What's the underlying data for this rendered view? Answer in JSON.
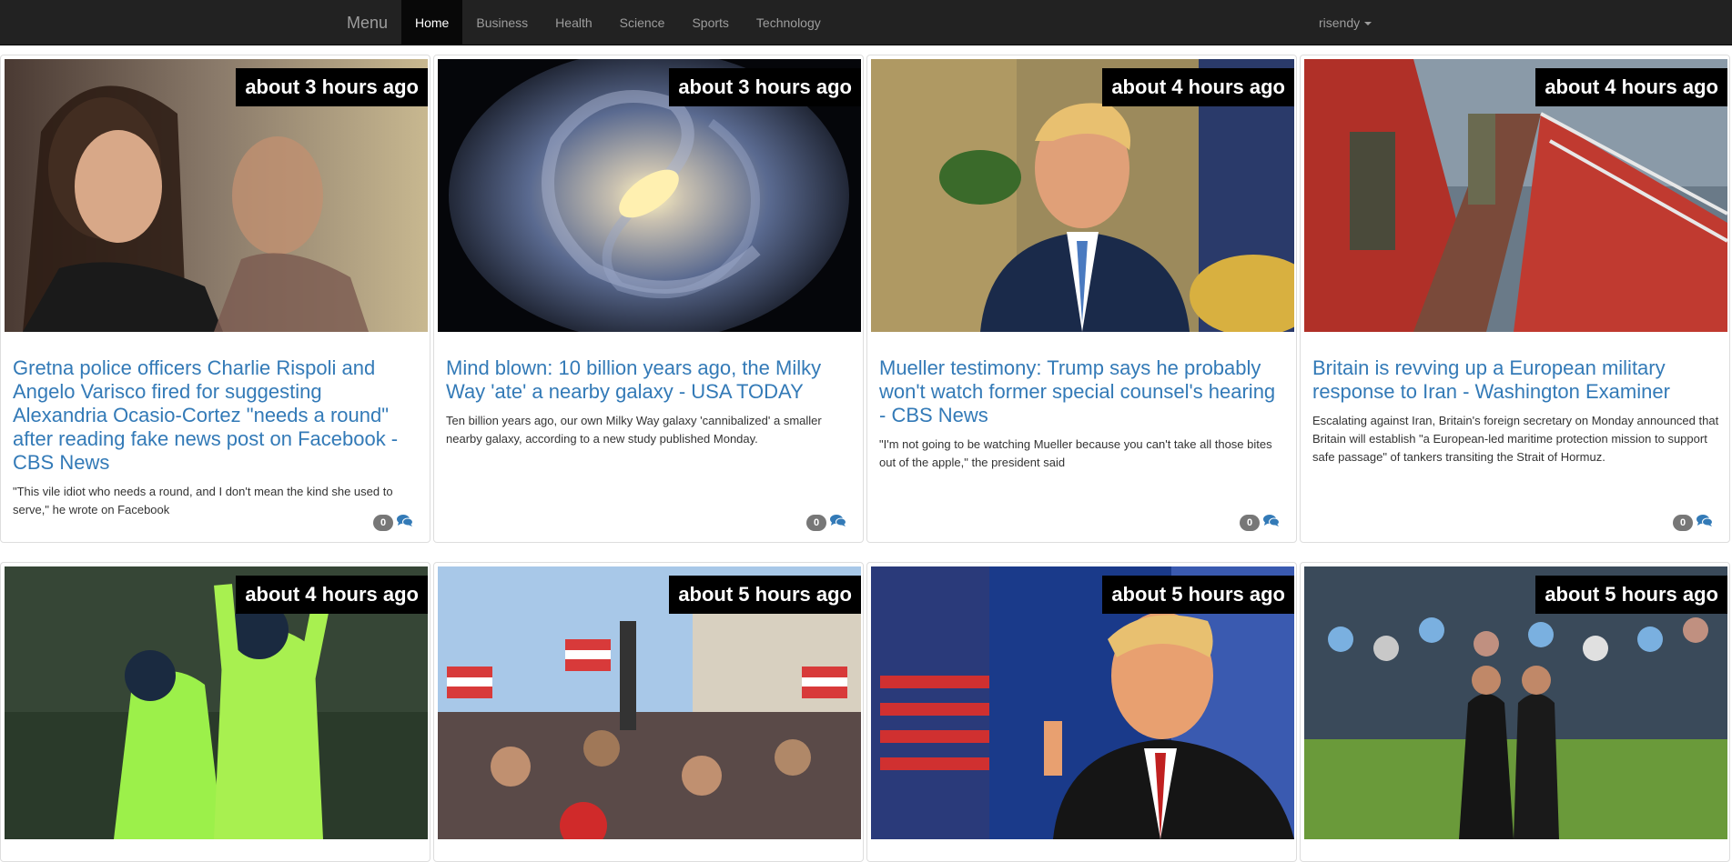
{
  "navbar": {
    "brand": "Menu",
    "links": [
      {
        "label": "Home",
        "active": true
      },
      {
        "label": "Business"
      },
      {
        "label": "Health"
      },
      {
        "label": "Science"
      },
      {
        "label": "Sports"
      },
      {
        "label": "Technology"
      }
    ],
    "user": "risendy"
  },
  "articles": [
    {
      "time": "about 3 hours ago",
      "title": "Gretna police officers Charlie Rispoli and Angelo Varisco fired for suggesting Alexandria Ocasio-Cortez \"needs a round\" after reading fake news post on Facebook - CBS News",
      "description": "\"This vile idiot who needs a round, and I don't mean the kind she used to serve,\" he wrote on Facebook",
      "comments": "0"
    },
    {
      "time": "about 3 hours ago",
      "title": "Mind blown: 10 billion years ago, the Milky Way 'ate' a nearby galaxy - USA TODAY",
      "description": "Ten billion years ago, our own Milky Way galaxy 'cannibalized' a smaller nearby galaxy, according to a new study published Monday.",
      "comments": "0"
    },
    {
      "time": "about 4 hours ago",
      "title": "Mueller testimony: Trump says he probably won't watch former special counsel's hearing - CBS News",
      "description": "\"I'm not going to be watching Mueller because you can't take all those bites out of the apple,\" the president said",
      "comments": "0"
    },
    {
      "time": "about 4 hours ago",
      "title": "Britain is revving up a European military response to Iran - Washington Examiner",
      "description": "Escalating against Iran, Britain's foreign secretary on Monday announced that Britain will establish \"a European-led maritime protection mission to support safe passage\" of tankers transiting the Strait of Hormuz.",
      "comments": "0"
    },
    {
      "time": "about 4 hours ago"
    },
    {
      "time": "about 5 hours ago"
    },
    {
      "time": "about 5 hours ago"
    },
    {
      "time": "about 5 hours ago"
    }
  ],
  "colors": {
    "navbar_bg": "#222222",
    "link": "#337ab7",
    "badge": "#777777"
  },
  "icons": {
    "comment": "comments-icon",
    "dropdown": "caret-down-icon"
  }
}
